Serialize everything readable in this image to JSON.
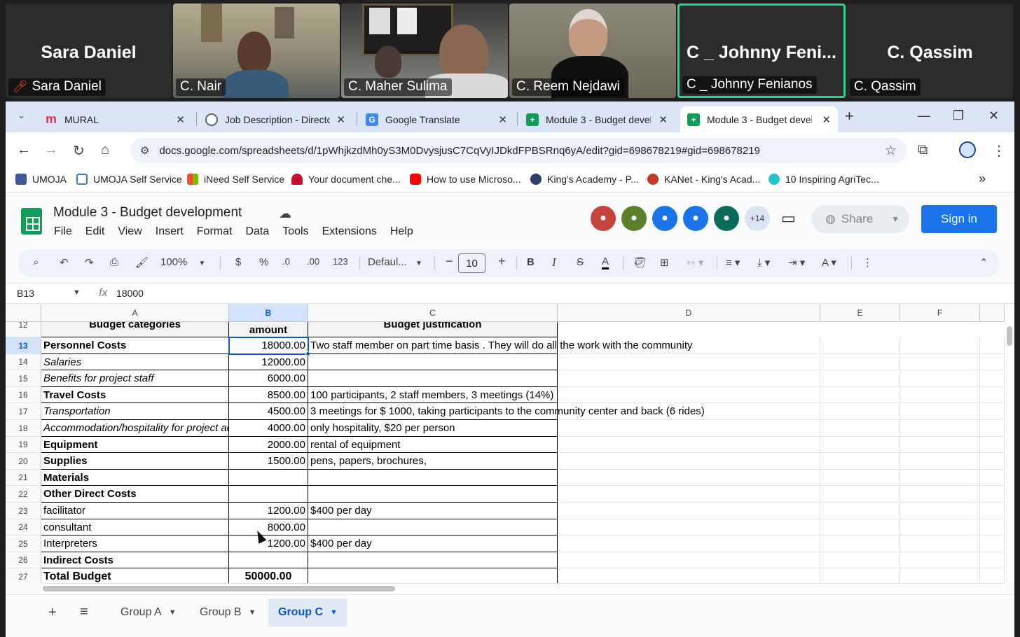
{
  "meeting": {
    "participants": [
      {
        "name": "Sara Daniel",
        "big_name": "Sara Daniel",
        "muted": true
      },
      {
        "name": "C. Nair"
      },
      {
        "name": "C. Maher Sulima"
      },
      {
        "name": "C. Reem Nejdawi"
      },
      {
        "name": "C _ Johnny Fenianos",
        "big_name": "C _ Johnny Feni...",
        "active": true
      },
      {
        "name": "C. Qassim",
        "big_name": "C. Qassim"
      }
    ]
  },
  "browser": {
    "tabs": [
      {
        "title": "MURAL",
        "close": "✕"
      },
      {
        "title": "Job Description - Directo",
        "close": "✕"
      },
      {
        "title": "Google Translate",
        "close": "✕"
      },
      {
        "title": "Module 3 - Budget devel",
        "close": "✕"
      },
      {
        "title": "Module 3 - Budget devel",
        "close": "✕"
      }
    ],
    "new_tab": "+",
    "url": "docs.google.com/spreadsheets/d/1pWhjkzdMh0yS3M0DvysjusC7CqVyIJDkdFPBSRnq6yA/edit?gid=698678219#gid=698678219",
    "bookmarks": [
      {
        "label": "UMOJA",
        "color": "#3c5a99"
      },
      {
        "label": "UMOJA Self Service",
        "color": "#4a78c2"
      },
      {
        "label": "iNeed Self Service",
        "color": "#f25022"
      },
      {
        "label": "Your document che...",
        "color": "#c8102e"
      },
      {
        "label": "How to use Microso...",
        "color": "#ff0000"
      },
      {
        "label": "King's Academy - P...",
        "color": "#2c3e6b"
      },
      {
        "label": "KANet - King's Acad...",
        "color": "#c0392b"
      },
      {
        "label": "10 Inspiring AgriTec...",
        "color": "#23c4c9"
      }
    ],
    "more_bookmarks": "»"
  },
  "sheets": {
    "doc_title": "Module 3 - Budget development",
    "menu": [
      "File",
      "Edit",
      "View",
      "Insert",
      "Format",
      "Data",
      "Tools",
      "Extensions",
      "Help"
    ],
    "collaborators_more": "+14",
    "share_label": "Share",
    "signin_label": "Sign in",
    "toolbar": {
      "zoom": "100%",
      "currency": "$",
      "percent": "%",
      "dec_decrease": ".0",
      "dec_increase": ".00",
      "number_fmt": "123",
      "font": "Defaul...",
      "font_size": "10",
      "bold": "B",
      "italic": "I",
      "strike": "S",
      "text_color": "A"
    },
    "formula_bar": {
      "name_box": "B13",
      "fx": "fx",
      "value": "18000"
    },
    "columns": [
      "A",
      "B",
      "C",
      "D",
      "E",
      "F"
    ],
    "header_row": {
      "row": "12",
      "a": "Budget categories",
      "b": "amount",
      "c": "Budget justification"
    },
    "rows": [
      {
        "row": "13",
        "a": "Personnel Costs",
        "b": "18000.00",
        "c": "Two staff member on part time basis .  They will do all the work with the community",
        "style": "b"
      },
      {
        "row": "14",
        "a": "Salaries",
        "b": "12000.00",
        "c": "",
        "style": "i"
      },
      {
        "row": "15",
        "a": "Benefits for project staff",
        "b": "6000.00",
        "c": "",
        "style": "i"
      },
      {
        "row": "16",
        "a": "Travel Costs",
        "b": "8500.00",
        "c": "100 participants, 2 staff members, 3 meetings (14%)",
        "style": "b"
      },
      {
        "row": "17",
        "a": "Transportation",
        "b": "4500.00",
        "c": "3 meetings for $ 1000, taking participants to the community center and back (6 rides)",
        "style": "i"
      },
      {
        "row": "18",
        "a": "Accommodation/hospitality for project activities",
        "b": "4000.00",
        "c": "only hospitality, $20 per person",
        "style": "i"
      },
      {
        "row": "19",
        "a": "Equipment",
        "b": "2000.00",
        "c": "rental of equipment",
        "style": "b"
      },
      {
        "row": "20",
        "a": "Supplies",
        "b": "1500.00",
        "c": "pens, papers, brochures,",
        "style": "b"
      },
      {
        "row": "21",
        "a": "Materials",
        "b": "",
        "c": "",
        "style": "b"
      },
      {
        "row": "22",
        "a": "Other Direct Costs",
        "b": "",
        "c": "",
        "style": "b"
      },
      {
        "row": "23",
        "a": "facilitator",
        "b": "1200.00",
        "c": "$400 per day",
        "style": ""
      },
      {
        "row": "24",
        "a": "consultant",
        "b": "8000.00",
        "c": "",
        "style": ""
      },
      {
        "row": "25",
        "a": "Interpreters",
        "b": "1200.00",
        "c": "$400 per day",
        "style": ""
      },
      {
        "row": "26",
        "a": "Indirect Costs",
        "b": "",
        "c": "",
        "style": "b"
      },
      {
        "row": "27",
        "a": "Total Budget",
        "b": "50000.00",
        "c": "",
        "style": "b"
      }
    ],
    "sheet_tabs": [
      {
        "label": "Group A",
        "active": false
      },
      {
        "label": "Group B",
        "active": false
      },
      {
        "label": "Group C",
        "active": true
      }
    ]
  }
}
